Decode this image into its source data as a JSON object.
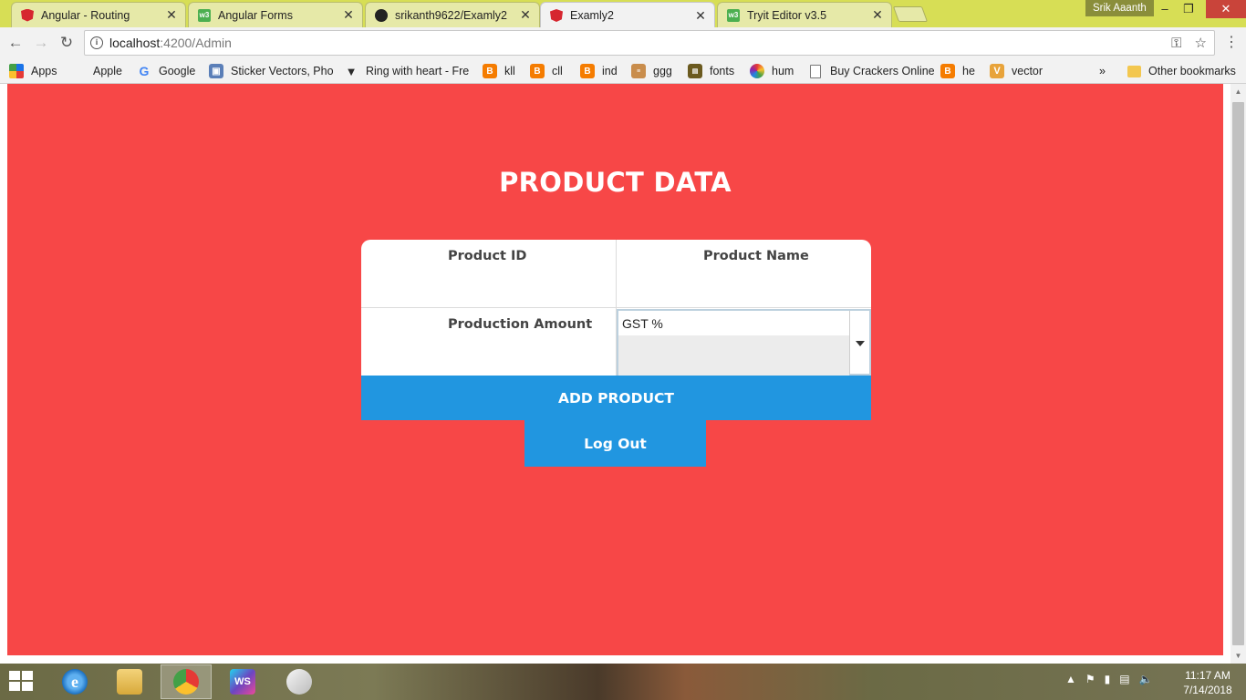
{
  "browser": {
    "tabs": [
      {
        "title": "Angular - Routing",
        "icon": "angular-icon"
      },
      {
        "title": "Angular Forms",
        "icon": "w3schools-icon"
      },
      {
        "title": "srikanth9622/Examly2",
        "icon": "github-icon"
      },
      {
        "title": "Examly2",
        "icon": "angular-icon",
        "active": true
      },
      {
        "title": "Tryit Editor v3.5",
        "icon": "w3schools-icon"
      }
    ],
    "profile_name": "Srik Aaanth",
    "url_host": "localhost",
    "url_path": ":4200/Admin",
    "bookmarks": [
      {
        "label": "Apps",
        "icon": "apps-icon"
      },
      {
        "label": "Apple",
        "icon": "apple-icon"
      },
      {
        "label": "Google",
        "icon": "google-icon"
      },
      {
        "label": "Sticker Vectors, Phot",
        "icon": "image-icon"
      },
      {
        "label": "Ring with heart - Fre",
        "icon": "heart-icon"
      },
      {
        "label": "kll",
        "icon": "blogger-icon"
      },
      {
        "label": "cll",
        "icon": "blogger-icon"
      },
      {
        "label": "ind",
        "icon": "blogger-icon"
      },
      {
        "label": "ggg",
        "icon": "ggg-icon"
      },
      {
        "label": "fonts",
        "icon": "fonts-icon"
      },
      {
        "label": "hum",
        "icon": "color-wheel-icon"
      },
      {
        "label": "Buy Crackers Online",
        "icon": "page-icon"
      },
      {
        "label": "he",
        "icon": "blogger-icon"
      },
      {
        "label": "vector",
        "icon": "vector-icon"
      }
    ],
    "bookmarks_overflow": "»",
    "other_bookmarks": "Other bookmarks"
  },
  "page": {
    "title": "PRODUCT DATA",
    "fields": {
      "product_id": "Product ID",
      "product_name": "Product Name",
      "production_amount": "Production Amount",
      "gst_select_value": "GST %"
    },
    "add_button": "ADD PRODUCT",
    "logout_button": "Log Out",
    "background_color": "#f74747",
    "button_color": "#2196e0"
  },
  "taskbar": {
    "time": "11:17 AM",
    "date": "7/14/2018",
    "apps": [
      "internet-explorer-icon",
      "file-explorer-icon",
      "chrome-icon",
      "webstorm-icon",
      "paint-icon"
    ]
  }
}
